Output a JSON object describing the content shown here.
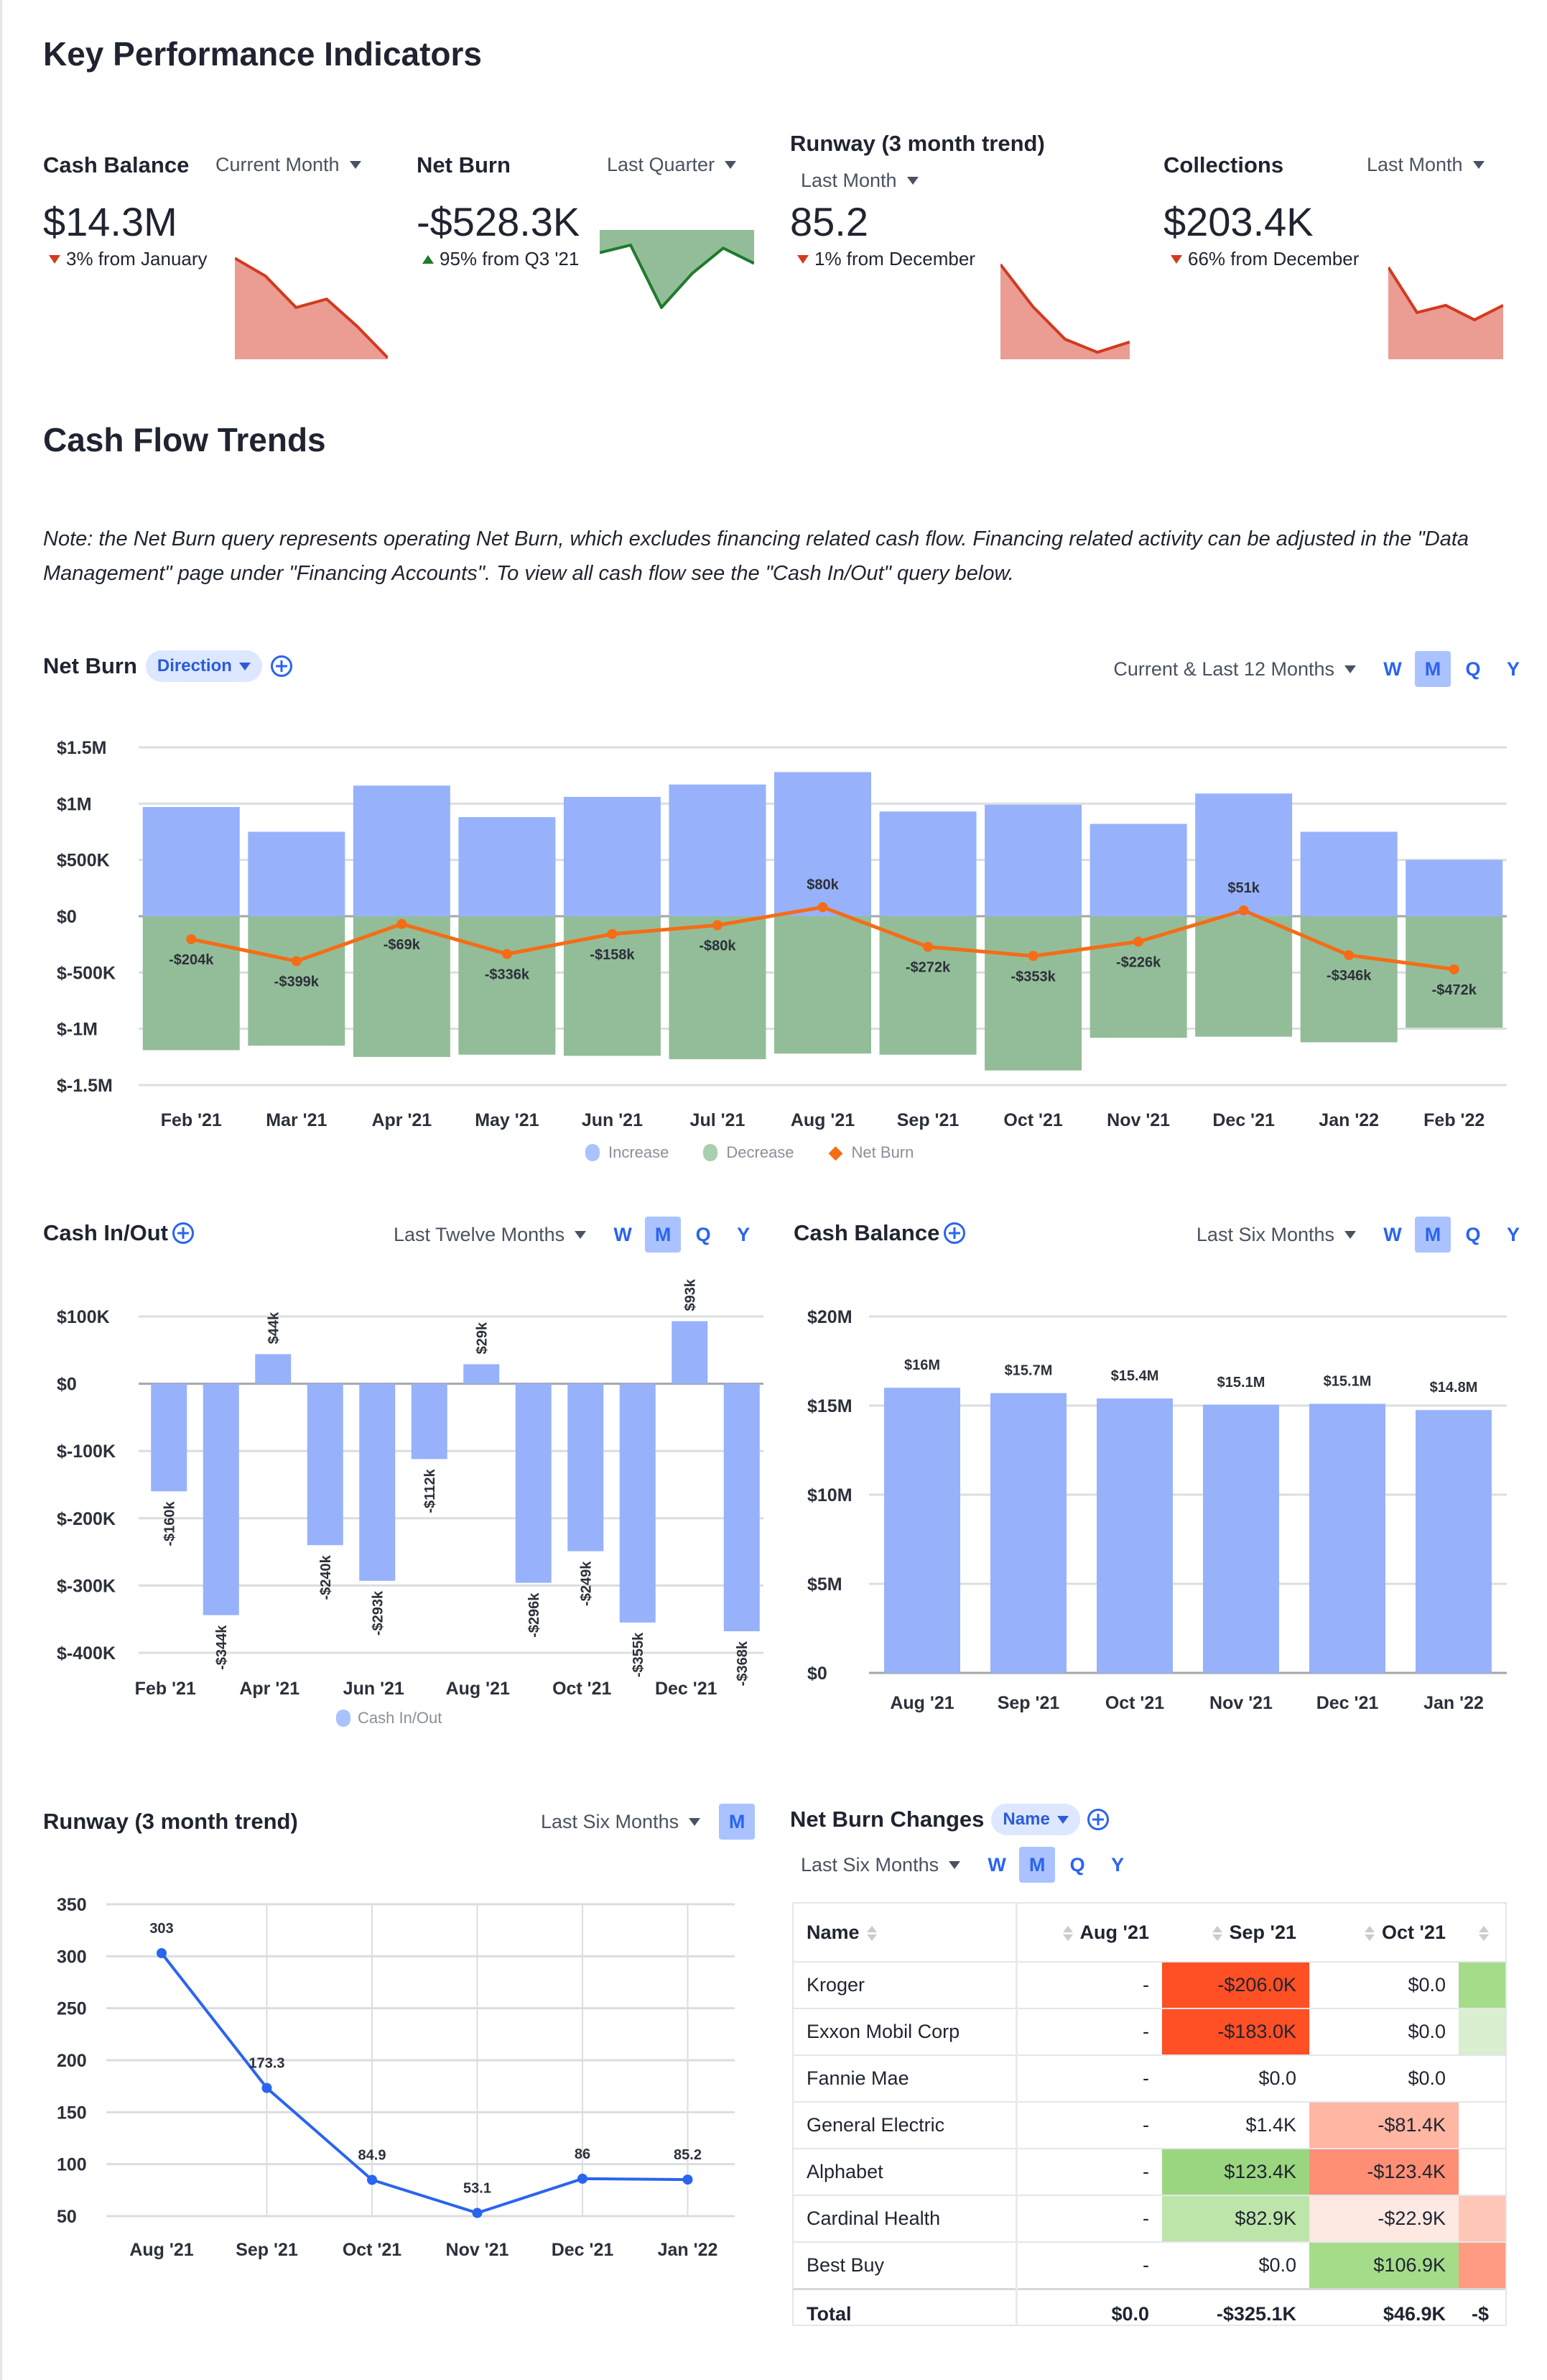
{
  "kpi_section": {
    "title": "Key Performance Indicators",
    "cards": [
      {
        "title": "Cash Balance",
        "period": "Current Month",
        "value": "$14.3M",
        "delta": "3% from January",
        "direction": "down",
        "trend": [
          0.95,
          0.78,
          0.48,
          0.56,
          0.3,
          0.0
        ]
      },
      {
        "title": "Net Burn",
        "period": "Last Quarter",
        "value": "-$528.3K",
        "delta": "95% from Q3 '21",
        "direction": "up",
        "trend": [
          0.72,
          0.82,
          0.0,
          0.45,
          0.78,
          0.58
        ]
      },
      {
        "title": "Runway (3 month trend)",
        "period": "Last Month",
        "value": "85.2",
        "delta": "1% from December",
        "direction": "down",
        "trend": [
          1.0,
          0.55,
          0.2,
          0.06,
          0.17
        ]
      },
      {
        "title": "Collections",
        "period": "Last Month",
        "value": "$203.4K",
        "delta": "66% from December",
        "direction": "down",
        "trend": [
          1.0,
          0.5,
          0.58,
          0.42,
          0.58
        ]
      }
    ]
  },
  "cash_flow_section": {
    "title": "Cash Flow Trends",
    "note": "Note: the Net Burn query represents operating Net Burn, which excludes financing related cash flow. Financing related activity can be adjusted in the \"Data Management\" page under \"Financing Accounts\". To view all cash flow see the \"Cash In/Out\" query below."
  },
  "net_burn_chart": {
    "title": "Net Burn",
    "group_pill": "Direction",
    "range": "Current & Last 12 Months",
    "periods": [
      "W",
      "M",
      "Q",
      "Y"
    ],
    "active_period": "M"
  },
  "cash_inout_chart": {
    "title": "Cash In/Out",
    "range": "Last Twelve Months",
    "periods": [
      "W",
      "M",
      "Q",
      "Y"
    ],
    "active_period": "M"
  },
  "cash_balance_chart": {
    "title": "Cash Balance",
    "range": "Last Six Months",
    "periods": [
      "W",
      "M",
      "Q",
      "Y"
    ],
    "active_period": "M"
  },
  "runway_chart": {
    "title": "Runway (3 month trend)",
    "range": "Last Six Months",
    "periods": [
      "M"
    ],
    "active_period": "M"
  },
  "net_burn_changes": {
    "title": "Net Burn Changes",
    "group_pill": "Name",
    "range": "Last Six Months",
    "periods": [
      "W",
      "M",
      "Q",
      "Y"
    ],
    "active_period": "M",
    "columns": [
      "Name",
      "Aug '21",
      "Sep '21",
      "Oct '21"
    ],
    "rows": [
      {
        "name": "Kroger",
        "cells": [
          "-",
          "-$206.0K",
          "$0.0"
        ],
        "colors": [
          "",
          "#ff4f24",
          "",
          "#a5dc8a"
        ]
      },
      {
        "name": "Exxon Mobil Corp",
        "cells": [
          "-",
          "-$183.0K",
          "$0.0"
        ],
        "colors": [
          "",
          "#ff4f24",
          "",
          "#d9efcf"
        ]
      },
      {
        "name": "Fannie Mae",
        "cells": [
          "-",
          "$0.0",
          "$0.0"
        ],
        "colors": [
          "",
          "",
          "",
          ""
        ]
      },
      {
        "name": "General Electric",
        "cells": [
          "-",
          "$1.4K",
          "-$81.4K"
        ],
        "colors": [
          "",
          "",
          "#ffb6a2",
          ""
        ]
      },
      {
        "name": "Alphabet",
        "cells": [
          "-",
          "$123.4K",
          "-$123.4K"
        ],
        "colors": [
          "",
          "#9ad67f",
          "#ff8f74",
          ""
        ]
      },
      {
        "name": "Cardinal Health",
        "cells": [
          "-",
          "$82.9K",
          "-$22.9K"
        ],
        "colors": [
          "",
          "#bde5a9",
          "#fde8e2",
          "#ffc7b8"
        ]
      },
      {
        "name": "Best Buy",
        "cells": [
          "-",
          "$0.0",
          "$106.9K"
        ],
        "colors": [
          "",
          "",
          "#a5dc8a",
          "#ff9b82"
        ]
      }
    ],
    "total": {
      "label": "Total",
      "cells": [
        "$0.0",
        "-$325.1K",
        "$46.9K",
        "-$"
      ]
    }
  },
  "chart_data": [
    {
      "id": "net_burn",
      "type": "bar",
      "title": "Net Burn",
      "categories": [
        "Feb '21",
        "Mar '21",
        "Apr '21",
        "May '21",
        "Jun '21",
        "Jul '21",
        "Aug '21",
        "Sep '21",
        "Oct '21",
        "Nov '21",
        "Dec '21",
        "Jan '22",
        "Feb '22"
      ],
      "series": [
        {
          "name": "Increase",
          "type": "bar",
          "color": "#97b2fb",
          "values": [
            970000,
            750000,
            1160000,
            880000,
            1060000,
            1170000,
            1280000,
            930000,
            990000,
            820000,
            1090000,
            750000,
            500000
          ]
        },
        {
          "name": "Decrease",
          "type": "bar",
          "color": "#93bd98",
          "values": [
            -1190000,
            -1150000,
            -1250000,
            -1230000,
            -1240000,
            -1270000,
            -1220000,
            -1230000,
            -1370000,
            -1080000,
            -1070000,
            -1120000,
            -990000
          ]
        },
        {
          "name": "Net Burn",
          "type": "line",
          "color": "#f46d16",
          "values": [
            -204000,
            -399000,
            -69000,
            -336000,
            -158000,
            -80000,
            80000,
            -272000,
            -353000,
            -226000,
            51000,
            -346000,
            -472000
          ],
          "labels": [
            "-$204k",
            "-$399k",
            "-$69k",
            "-$336k",
            "-$158k",
            "-$80k",
            "$80k",
            "-$272k",
            "-$353k",
            "-$226k",
            "$51k",
            "-$346k",
            "-$472k"
          ]
        }
      ],
      "yticks": [
        1500000,
        1000000,
        500000,
        0,
        -500000,
        -1000000,
        -1500000
      ],
      "ytick_labels": [
        "$1.5M",
        "$1M",
        "$500K",
        "$0",
        "$-500K",
        "$-1M",
        "$-1.5M"
      ],
      "ylim": [
        -1500000,
        1500000
      ],
      "grid": true,
      "legend": "bottom-center",
      "legend_entries": [
        "Increase",
        "Decrease",
        "Net Burn"
      ]
    },
    {
      "id": "cash_inout",
      "type": "bar",
      "title": "Cash In/Out",
      "categories": [
        "Feb '21",
        "Mar '21",
        "Apr '21",
        "May '21",
        "Jun '21",
        "Jul '21",
        "Aug '21",
        "Sep '21",
        "Oct '21",
        "Nov '21",
        "Dec '21",
        "Jan '22"
      ],
      "xtick_labels": [
        "Feb '21",
        "",
        "Apr '21",
        "",
        "Jun '21",
        "",
        "Aug '21",
        "",
        "Oct '21",
        "",
        "Dec '21",
        ""
      ],
      "values": [
        -160000,
        -344000,
        44000,
        -240000,
        -293000,
        -112000,
        29000,
        -296000,
        -249000,
        -355000,
        93000,
        -368000
      ],
      "labels": [
        "-$160k",
        "-$344k",
        "$44k",
        "-$240k",
        "-$293k",
        "-$112k",
        "$29k",
        "-$296k",
        "-$249k",
        "-$355k",
        "$93k",
        "-$368k"
      ],
      "color": "#97b2fb",
      "yticks": [
        100000,
        0,
        -100000,
        -200000,
        -300000,
        -400000
      ],
      "ytick_labels": [
        "$100K",
        "$0",
        "$-100K",
        "$-200K",
        "$-300K",
        "$-400K"
      ],
      "ylim": [
        -400000,
        100000
      ],
      "grid": true,
      "legend": "bottom-center",
      "legend_entries": [
        "Cash In/Out"
      ]
    },
    {
      "id": "cash_balance",
      "type": "bar",
      "title": "Cash Balance",
      "categories": [
        "Aug '21",
        "Sep '21",
        "Oct '21",
        "Nov '21",
        "Dec '21",
        "Jan '22"
      ],
      "values": [
        16000000,
        15700000,
        15400000,
        15050000,
        15100000,
        14750000
      ],
      "labels": [
        "$16M",
        "$15.7M",
        "$15.4M",
        "$15.1M",
        "$15.1M",
        "$14.8M"
      ],
      "color": "#97b2fb",
      "yticks": [
        20000000,
        15000000,
        10000000,
        5000000,
        0
      ],
      "ytick_labels": [
        "$20M",
        "$15M",
        "$10M",
        "$5M",
        "$0"
      ],
      "ylim": [
        0,
        20000000
      ],
      "grid": true
    },
    {
      "id": "runway",
      "type": "line",
      "title": "Runway (3 month trend)",
      "categories": [
        "Aug '21",
        "Sep '21",
        "Oct '21",
        "Nov '21",
        "Dec '21",
        "Jan '22"
      ],
      "values": [
        303,
        173.3,
        84.9,
        53.1,
        86,
        85.2
      ],
      "labels": [
        "303",
        "173.3",
        "84.9",
        "53.1",
        "86",
        "85.2"
      ],
      "color": "#2a64f0",
      "yticks": [
        350,
        300,
        250,
        200,
        150,
        100,
        50
      ],
      "ytick_labels": [
        "350",
        "300",
        "250",
        "200",
        "150",
        "100",
        "50"
      ],
      "ylim": [
        50,
        350
      ],
      "grid": true
    }
  ]
}
